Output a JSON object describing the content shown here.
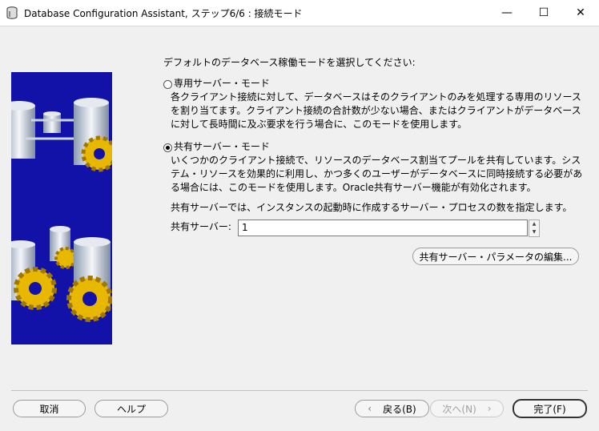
{
  "window": {
    "title": "Database Configuration Assistant, ステップ6/6 : 接続モード",
    "minimize": "—",
    "maximize": "☐",
    "close": "✕"
  },
  "main": {
    "prompt": "デフォルトのデータベース稼働モードを選択してください:",
    "dedicated": {
      "label": "専用サーバー・モード",
      "selected": false,
      "desc_lines": [
        "各クライアント接続に対して、データベースはそのクライアントのみを処理する専用のリソース",
        "を割り当てます。クライアント接続の合計数が少ない場合、またはクライアントがデータベース",
        "に対して長時間に及ぶ要求を行う場合に、このモードを使用します。"
      ]
    },
    "shared": {
      "label": "共有サーバー・モード",
      "selected": true,
      "desc_lines": [
        "いくつかのクライアント接続で、リソースのデータベース割当てプールを共有しています。シス",
        "テム・リソースを効果的に利用し、かつ多くのユーザーがデータベースに同時接続する必要があ",
        "る場合には、このモードを使用します。Oracle共有サーバー機能が有効化されます。"
      ],
      "info": "共有サーバーでは、インスタンスの起動時に作成するサーバー・プロセスの数を指定します。",
      "servers_label": "共有サーバー:",
      "servers_value": "1",
      "params_button": "共有サーバー・パラメータの編集..."
    }
  },
  "buttons": {
    "cancel": "取消",
    "help": "ヘルプ",
    "back": "戻る(B)",
    "next": "次へ(N)",
    "finish": "完了(F)"
  },
  "colors": {
    "art_bg": "#1212a8",
    "gear": "#e8b800"
  }
}
